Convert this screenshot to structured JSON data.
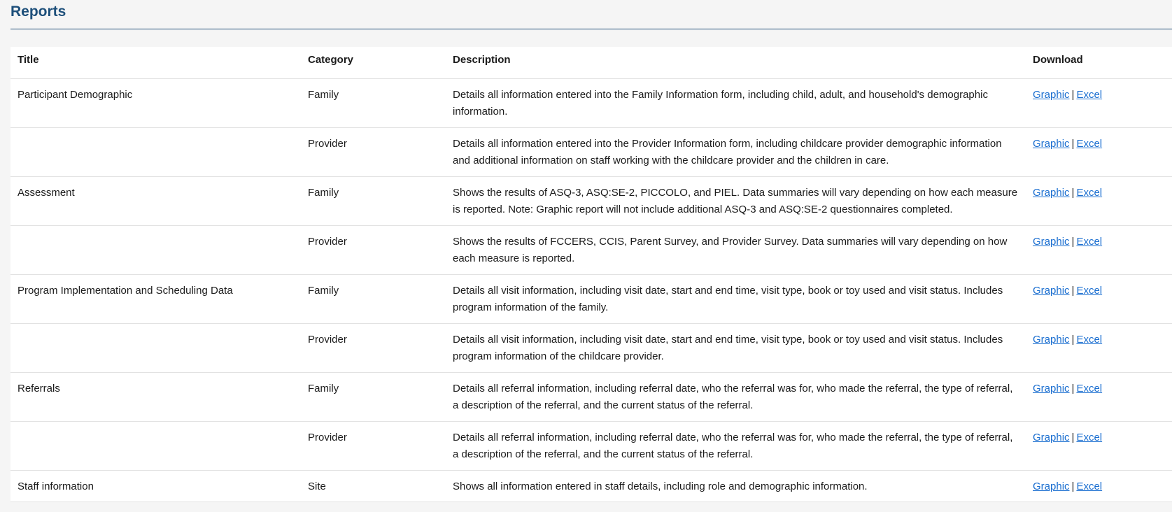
{
  "header": {
    "title": "Reports"
  },
  "table": {
    "columns": {
      "title": "Title",
      "category": "Category",
      "description": "Description",
      "download": "Download"
    },
    "link_graphic": "Graphic",
    "link_separator": "|",
    "link_excel": "Excel",
    "rows": [
      {
        "title": "Participant Demographic",
        "category": "Family",
        "description": "Details all information entered into the Family Information form, including child, adult, and household's demographic information."
      },
      {
        "title": "",
        "category": "Provider",
        "description": "Details all information entered into the Provider Information form, including childcare provider demographic information and additional information on staff working with the childcare provider and the children in care."
      },
      {
        "title": "Assessment",
        "category": "Family",
        "description": "Shows the results of ASQ-3, ASQ:SE-2, PICCOLO, and PIEL. Data summaries will vary depending on how each measure is reported. Note: Graphic report will not include additional ASQ-3 and ASQ:SE-2 questionnaires completed."
      },
      {
        "title": "",
        "category": "Provider",
        "description": "Shows the results of FCCERS, CCIS, Parent Survey, and Provider Survey. Data summaries will vary depending on how each measure is reported."
      },
      {
        "title": "Program Implementation and Scheduling Data",
        "category": "Family",
        "description": "Details all visit information, including visit date, start and end time, visit type, book or toy used and visit status. Includes program information of the family."
      },
      {
        "title": "",
        "category": "Provider",
        "description": "Details all visit information, including visit date, start and end time, visit type, book or toy used and visit status. Includes program information of the childcare provider."
      },
      {
        "title": "Referrals",
        "category": "Family",
        "description": "Details all referral information, including referral date, who the referral was for, who made the referral, the type of referral, a description of the referral, and the current status of the referral."
      },
      {
        "title": "",
        "category": "Provider",
        "description": "Details all referral information, including referral date, who the referral was for, who made the referral, the type of referral, a description of the referral, and the current status of the referral."
      },
      {
        "title": "Staff information",
        "category": "Site",
        "description": "Shows all information entered in staff details, including role and demographic information."
      }
    ]
  },
  "colors": {
    "title": "#1d4f7a",
    "link": "#1a6ed0",
    "background": "#f5f5f5"
  }
}
